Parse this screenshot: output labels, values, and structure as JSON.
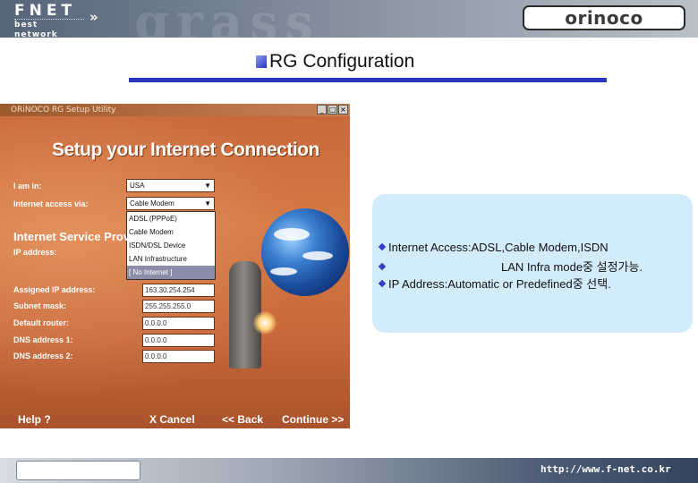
{
  "header": {
    "brand_name": "FNET",
    "brand_tagline": "best network",
    "brand_arrows": "»",
    "partner_logo": "orinoco",
    "background_word": "grass"
  },
  "page_title": "RG Configuration",
  "screenshot": {
    "window_title": "ORiNOCO RG Setup Utility",
    "heading": "Setup your Internet Connection",
    "labels": {
      "i_am_in": "I am in:",
      "access_via": "Internet access via:",
      "isp_heading": "Internet Service Provi",
      "ip_address": "IP address:",
      "assigned_ip": "Assigned IP address:",
      "subnet_mask": "Subnet mask:",
      "default_router": "Default router:",
      "dns1": "DNS address 1:",
      "dns2": "DNS address 2:"
    },
    "country_select": "USA",
    "access_select": "Cable Modem",
    "access_options": [
      "ADSL (PPPoE)",
      "Cable Modem",
      "ISDN/DSL Device",
      "LAN Infrastructure",
      "[ No Internet ]"
    ],
    "selected_option_index": 4,
    "fields": {
      "assigned_ip": "163.30.254.254",
      "subnet_mask": "255.255.255.0",
      "default_router": "0.0.0.0",
      "dns1": "0.0.0.0",
      "dns2": "0.0.0.0"
    },
    "buttons": {
      "help": "Help ?",
      "cancel": "X Cancel",
      "back": "<< Back",
      "continue": "Continue >>"
    },
    "window_controls": [
      "_",
      "□",
      "×"
    ]
  },
  "note": {
    "line1": "Internet Access:ADSL,Cable Modem,ISDN",
    "line2": "LAN Infra mode중 설정가능.",
    "line3": "IP Address:Automatic or Predefined중 선택."
  },
  "footer": {
    "url": "http://www.f-net.co.kr"
  },
  "colors": {
    "title_rule": "#2a35c0",
    "setup_background": "#c8693a",
    "note_background": "#d3ecfb"
  }
}
